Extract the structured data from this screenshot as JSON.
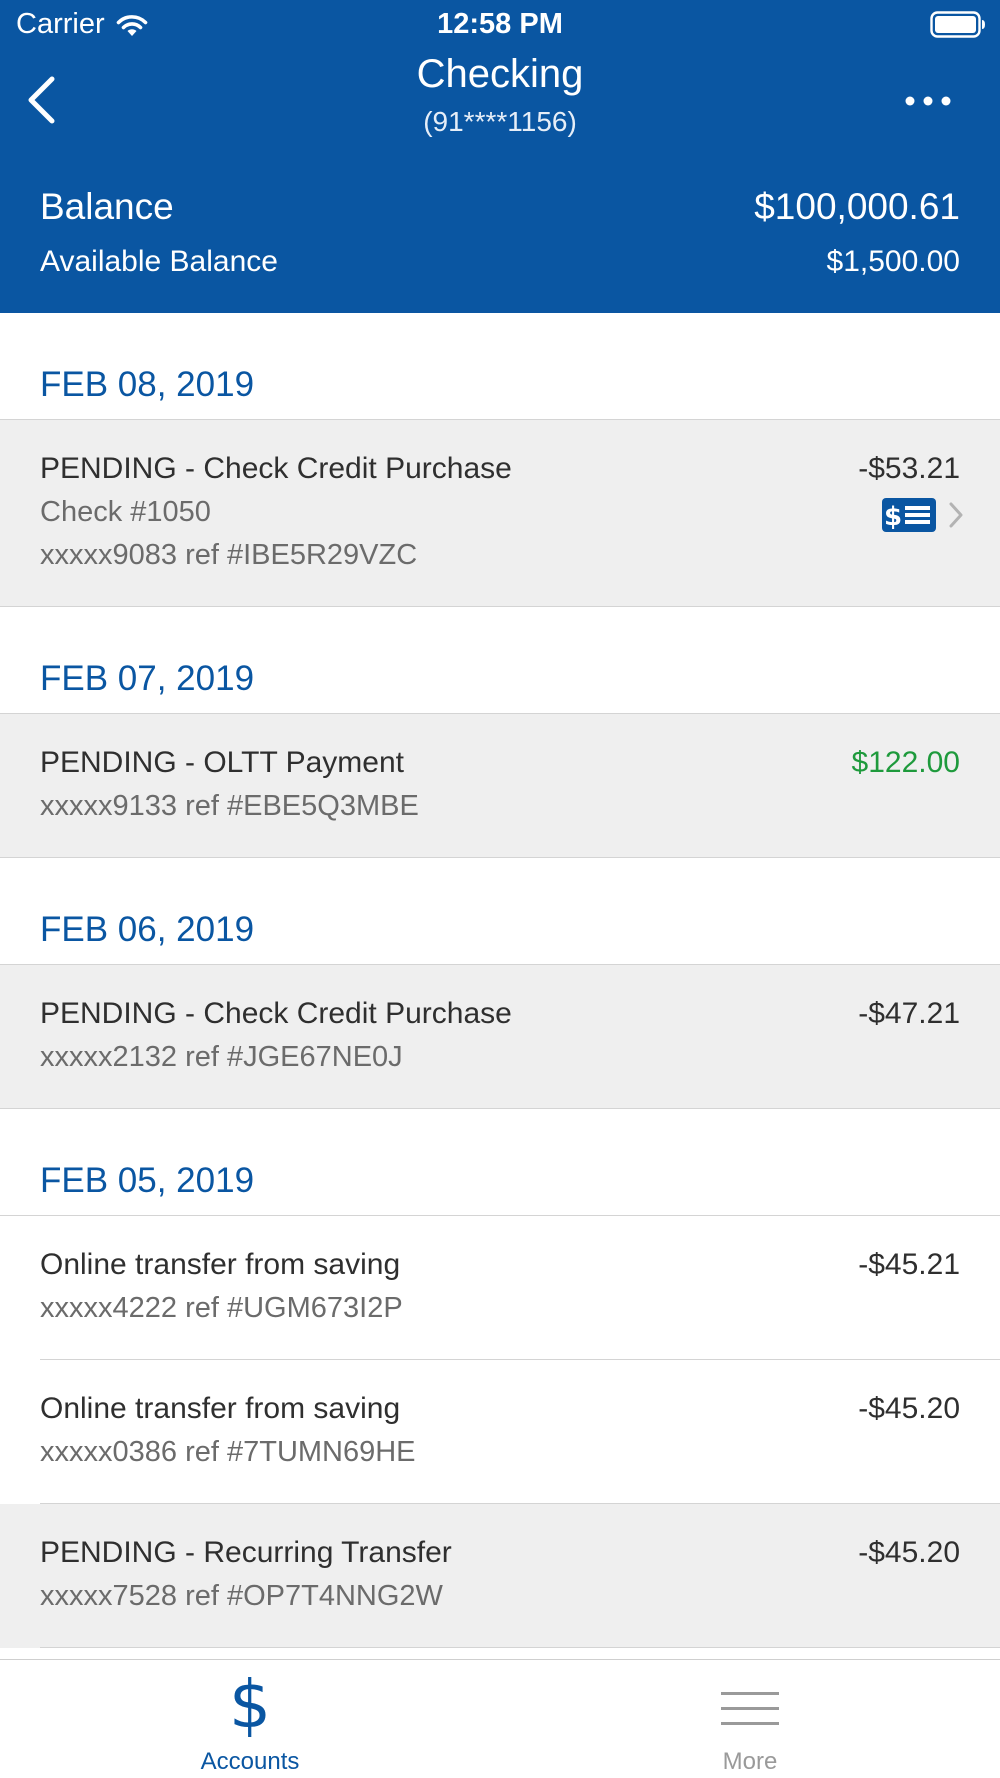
{
  "status_bar": {
    "carrier": "Carrier",
    "time": "12:58 PM"
  },
  "nav": {
    "title": "Checking",
    "subtitle": "(91****1156)",
    "back_icon": "chevron-left-icon",
    "more_icon": "ellipsis-icon"
  },
  "balance": {
    "label": "Balance",
    "value": "$100,000.61",
    "available_label": "Available Balance",
    "available_value": "$1,500.00"
  },
  "groups": [
    {
      "date": "FEB 08, 2019",
      "transactions": [
        {
          "description": "PENDING - Check Credit Purchase",
          "check": "Check #1050",
          "ref": "xxxxx9083 ref #IBE5R29VZC",
          "amount": "-$53.21",
          "pending": true,
          "has_check_image": true
        }
      ]
    },
    {
      "date": "FEB 07, 2019",
      "transactions": [
        {
          "description": "PENDING - OLTT Payment",
          "ref": "xxxxx9133 ref #EBE5Q3MBE",
          "amount": "$122.00",
          "pending": true,
          "credit": true
        }
      ]
    },
    {
      "date": "FEB 06, 2019",
      "transactions": [
        {
          "description": "PENDING - Check Credit Purchase",
          "ref": "xxxxx2132 ref #JGE67NE0J",
          "amount": "-$47.21",
          "pending": true
        }
      ]
    },
    {
      "date": "FEB 05, 2019",
      "transactions": [
        {
          "description": "Online transfer from saving",
          "ref": "xxxxx4222 ref #UGM673I2P",
          "amount": "-$45.21",
          "pending": false
        },
        {
          "description": "Online transfer from saving",
          "ref": "xxxxx0386 ref #7TUMN69HE",
          "amount": "-$45.20",
          "pending": false
        },
        {
          "description": "PENDING - Recurring Transfer",
          "ref": "xxxxx7528 ref #OP7T4NNG2W",
          "amount": "-$45.20",
          "pending": true
        }
      ]
    }
  ],
  "tabbar": {
    "accounts_label": "Accounts",
    "accounts_icon": "dollar-icon",
    "more_label": "More",
    "more_icon": "hamburger-menu-icon"
  },
  "colors": {
    "brand": "#0a56a2",
    "credit": "#1e9a3c",
    "pending_bg": "#efefef"
  }
}
